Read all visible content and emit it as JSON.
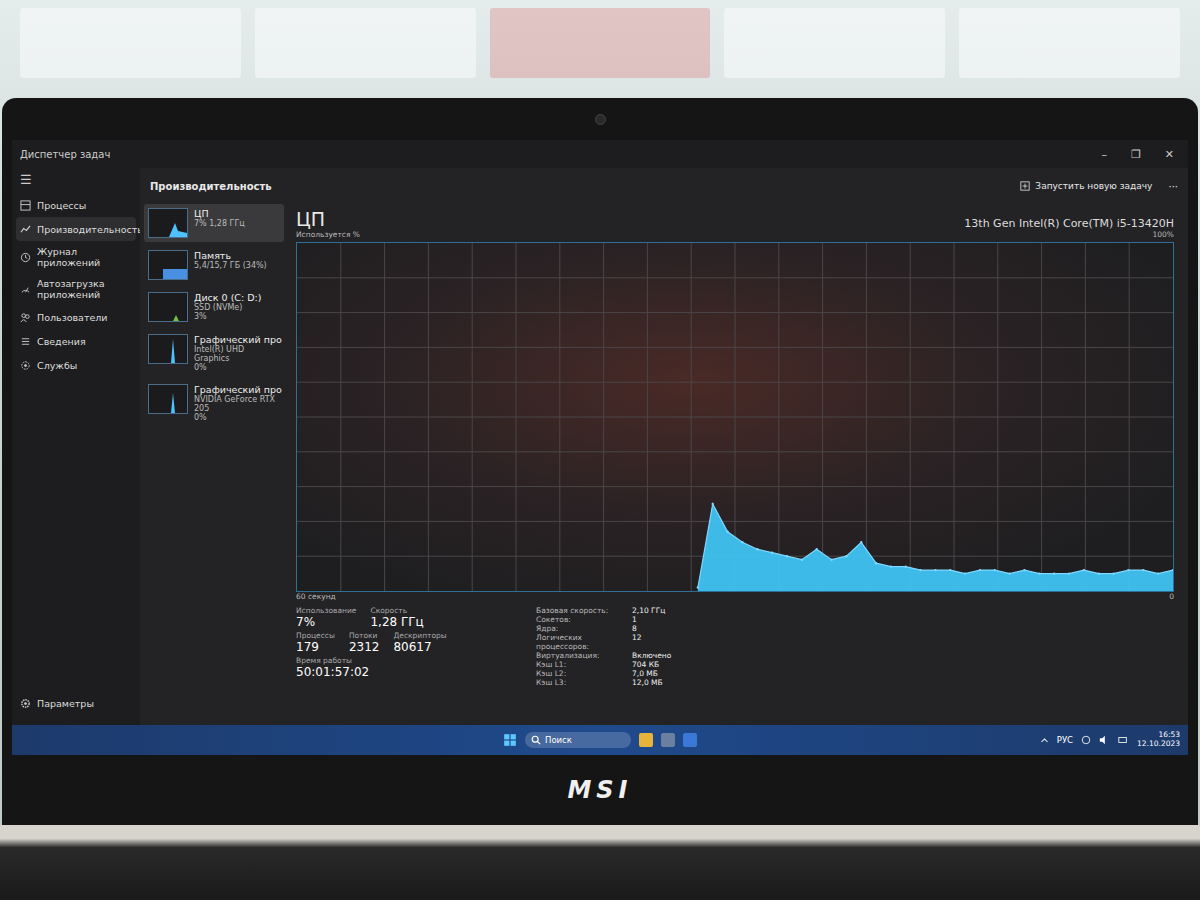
{
  "window": {
    "title": "Диспетчер задач",
    "controls": [
      "–",
      "❐",
      "✕"
    ]
  },
  "sidebar": {
    "menu": "☰",
    "items": [
      {
        "label": "Процессы",
        "selected": false
      },
      {
        "label": "Производительность",
        "selected": true
      },
      {
        "label": "Журнал приложений",
        "selected": false
      },
      {
        "label": "Автозагрузка приложений",
        "selected": false
      },
      {
        "label": "Пользователи",
        "selected": false
      },
      {
        "label": "Сведения",
        "selected": false
      },
      {
        "label": "Службы",
        "selected": false
      }
    ],
    "settings": "Параметры"
  },
  "header": {
    "title": "Производительность",
    "new_task": "Запустить новую задачу",
    "more": "···"
  },
  "devices": [
    {
      "name": "ЦП",
      "lines": [
        "7% 1,28 ГГц"
      ],
      "selected": true
    },
    {
      "name": "Память",
      "lines": [
        "5,4/15,7 ГБ (34%)"
      ],
      "selected": false
    },
    {
      "name": "Диск 0 (C: D:)",
      "lines": [
        "SSD (NVMe)",
        "3%"
      ],
      "selected": false
    },
    {
      "name": "Графический про",
      "lines": [
        "Intel(R) UHD Graphics",
        "0%"
      ],
      "selected": false
    },
    {
      "name": "Графический про",
      "lines": [
        "NVIDIA GeForce RTX 205",
        "0%"
      ],
      "selected": false
    }
  ],
  "cpu": {
    "title": "ЦП",
    "model": "13th Gen Intel(R) Core(TM) i5-13420H",
    "axis_label": "Используется %",
    "max": "100%",
    "span": "60 секунд",
    "min": "0",
    "values": [
      1,
      25,
      17,
      14,
      12,
      11,
      10,
      9,
      12,
      9,
      10,
      14,
      8,
      7,
      7,
      6,
      6,
      6,
      5,
      6,
      6,
      5,
      6,
      5,
      5,
      5,
      6,
      5,
      5,
      6,
      6,
      5,
      6
    ],
    "stats": [
      [
        {
          "label": "Использование",
          "value": "7%"
        },
        {
          "label": "Скорость",
          "value": "1,28 ГГц"
        }
      ],
      [
        {
          "label": "Процессы",
          "value": "179"
        },
        {
          "label": "Потоки",
          "value": "2312"
        },
        {
          "label": "Дескрипторы",
          "value": "80617"
        }
      ],
      [
        {
          "label": "Время работы",
          "value": "50:01:57:02"
        }
      ]
    ],
    "specs": [
      {
        "label": "Базовая скорость:",
        "value": "2,10 ГГц"
      },
      {
        "label": "Сокетов:",
        "value": "1"
      },
      {
        "label": "Ядра:",
        "value": "8"
      },
      {
        "label": "Логических процессоров:",
        "value": "12"
      },
      {
        "label": "Виртуализация:",
        "value": "Включено"
      },
      {
        "label": "Кэш L1:",
        "value": "704 КБ"
      },
      {
        "label": "Кэш L2:",
        "value": "7,0 МБ"
      },
      {
        "label": "Кэш L3:",
        "value": "12,0 МБ"
      }
    ]
  },
  "taskbar": {
    "search": "Поиск",
    "lang": "РУС",
    "time": "16:53",
    "date": "12.10.2023"
  },
  "laptop": {
    "logo": "MSI"
  }
}
